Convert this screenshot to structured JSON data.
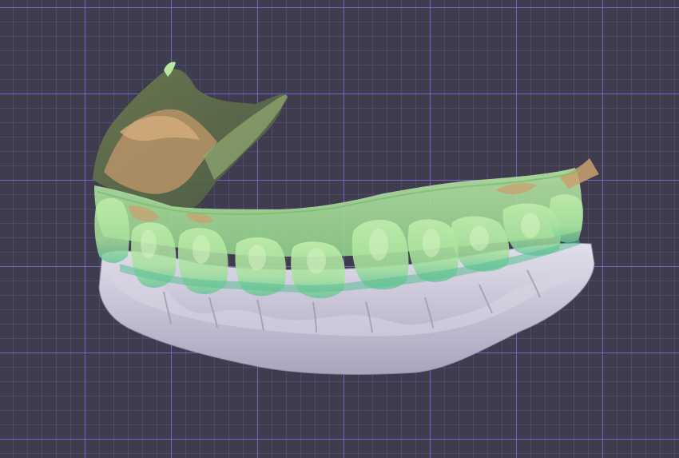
{
  "viewport": {
    "background_color": "#3f3c4e",
    "grid_major_color": "#7a6fe0",
    "grid_minor_color": "#5f5a96"
  },
  "model": {
    "lower_arch_color": "#c9c6d6",
    "upper_arch_color": "#9fd88f",
    "wax_up_color": "#7fcf9a",
    "tissue_color": "#c9a06f"
  }
}
